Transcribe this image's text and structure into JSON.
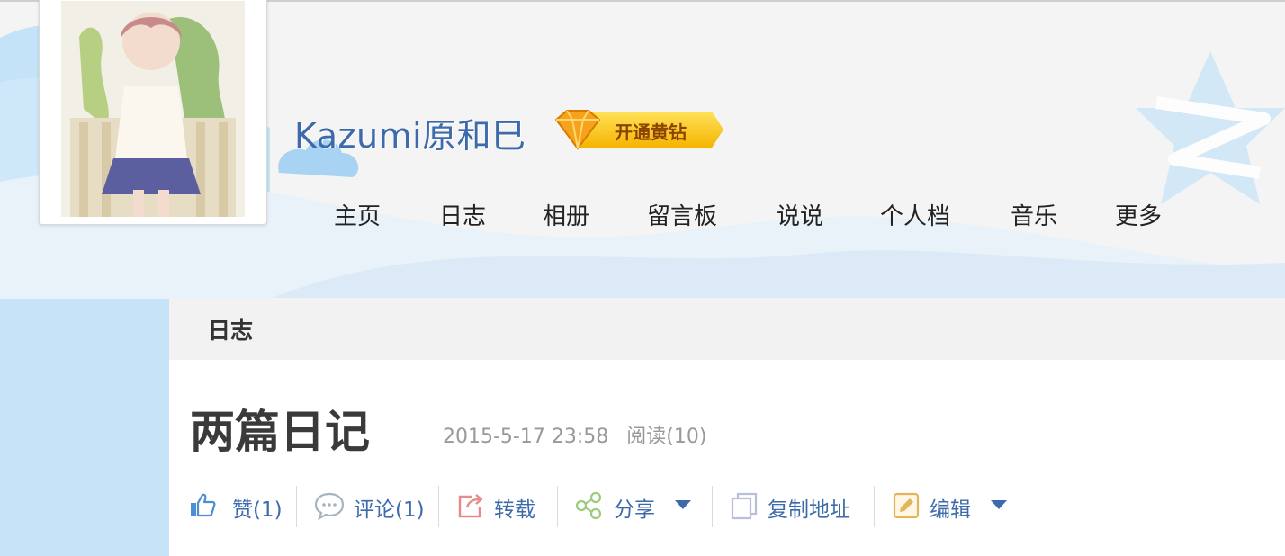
{
  "profile": {
    "nickname": "Kazumi原和巳",
    "vip_badge_label": "开通黄钻"
  },
  "nav": {
    "items": [
      "主页",
      "日志",
      "相册",
      "留言板",
      "说说",
      "个人档",
      "音乐",
      "更多"
    ]
  },
  "section": {
    "title": "日志"
  },
  "post": {
    "title": "两篇日记",
    "date": "2015-5-17 23:58",
    "views": "阅读(10)"
  },
  "actions": {
    "like": "赞(1)",
    "comment": "评论(1)",
    "repost": "转载",
    "share": "分享",
    "copy_link": "复制地址",
    "edit": "编辑"
  },
  "colors": {
    "link_blue": "#3d6aaa",
    "sky_blue": "#bfe0f7",
    "badge_gold": "#f5b400"
  },
  "icons": {
    "like": "thumbs-up-icon",
    "comment": "speech-bubble-icon",
    "repost": "repost-arrow-icon",
    "share": "share-nodes-icon",
    "copy_link": "copy-icon",
    "edit": "edit-pencil-icon",
    "vip": "diamond-icon",
    "logo": "qzone-star-logo"
  }
}
